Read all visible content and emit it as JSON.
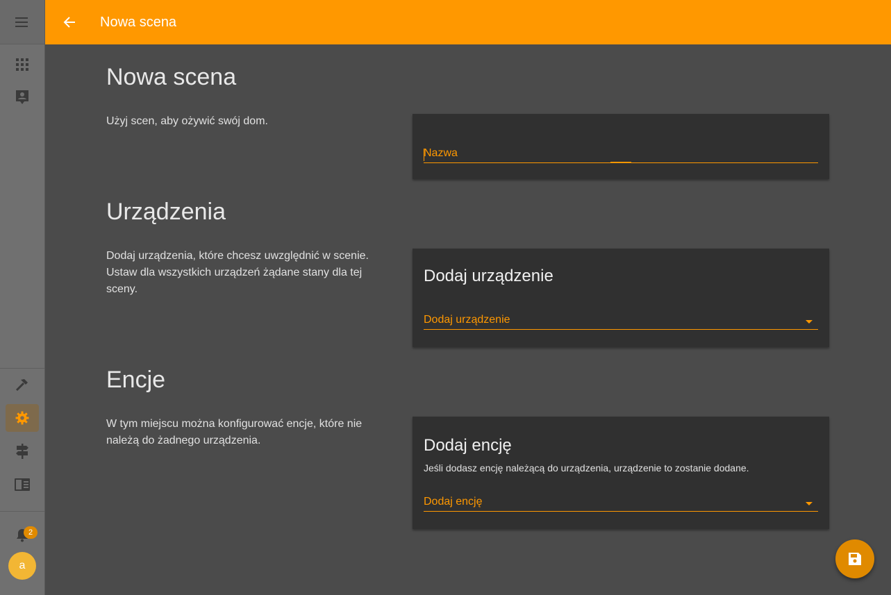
{
  "colors": {
    "accent": "#ff9800",
    "sidebar": "#707070",
    "background": "#4b4b4b",
    "card": "#303030"
  },
  "sidebar": {
    "items": [
      {
        "icon": "menu-icon"
      },
      {
        "icon": "apps-grid-icon"
      },
      {
        "icon": "person-card-icon"
      },
      {
        "icon": "hammer-icon"
      },
      {
        "icon": "gear-icon",
        "active": true
      },
      {
        "icon": "signpost-icon"
      },
      {
        "icon": "book-icon"
      }
    ],
    "notifications": {
      "icon": "bell-icon",
      "count": "2"
    },
    "avatar_letter": "a"
  },
  "header": {
    "title": "Nowa scena",
    "back_icon": "arrow-left-icon"
  },
  "sections": {
    "scene": {
      "title": "Nowa scena",
      "description": "Użyj scen, aby ożywić swój dom.",
      "name_field_label": "Nazwa"
    },
    "devices": {
      "title": "Urządzenia",
      "description": "Dodaj urządzenia, które chcesz uwzględnić w scenie. Ustaw dla wszystkich urządzeń żądane stany dla tej sceny.",
      "card_title": "Dodaj urządzenie",
      "select_label": "Dodaj urządzenie"
    },
    "entities": {
      "title": "Encje",
      "description": "W tym miejscu można konfigurować encje, które nie należą do żadnego urządzenia.",
      "card_title": "Dodaj encję",
      "card_note": "Jeśli dodasz encję należącą do urządzenia, urządzenie to zostanie dodane.",
      "select_label": "Dodaj encję"
    }
  },
  "fab": {
    "icon": "save-icon"
  }
}
